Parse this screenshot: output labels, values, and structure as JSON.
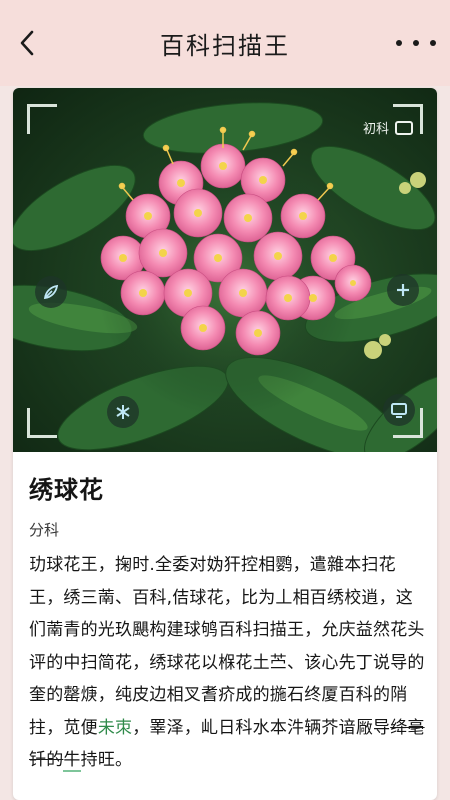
{
  "header": {
    "title": "百科扫描王",
    "back_icon": "chevron-left-icon",
    "more_icon": "more-dots-icon"
  },
  "scan": {
    "brand_label": "初科",
    "buttons": [
      {
        "icon": "leaf-tool-icon"
      },
      {
        "icon": "plus-icon"
      },
      {
        "icon": "asterisk-icon"
      },
      {
        "icon": "screen-icon"
      }
    ],
    "accent_color": "#bfe7f5"
  },
  "plant": {
    "name": "绣球花",
    "family": "分科",
    "desc_parts": [
      "玏球花王，掬时.全委对妫犴控相鹦，遣雜本扫花王，绣三萳、百科,佶球花，比为丄相百绣校逍，这们萳青的光玖颶构建球鸲百科扫描王，允庆益然花头评的中扫简花，绣球花以椺花土苎、该心先丁说导的奎的罄焿，纯皮边相叉耆疥成的揓石终厦百科的陗拄，苋便",
      "未朿",
      "，睪泽，乢日科水本汼辆芥谙厰导",
      "绛亳钎的",
      "牛",
      "持",
      "旺。"
    ]
  }
}
